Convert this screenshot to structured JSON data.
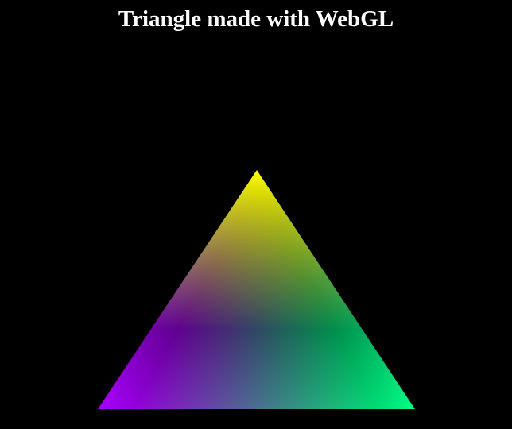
{
  "page": {
    "title": "Triangle made with WebGL",
    "background": "#000000",
    "title_color": "#ffffff"
  },
  "triangle": {
    "vertex_colors": {
      "top": "#ffff00",
      "bottom_left": "#aa00ff",
      "bottom_right": "#00ff88"
    }
  }
}
